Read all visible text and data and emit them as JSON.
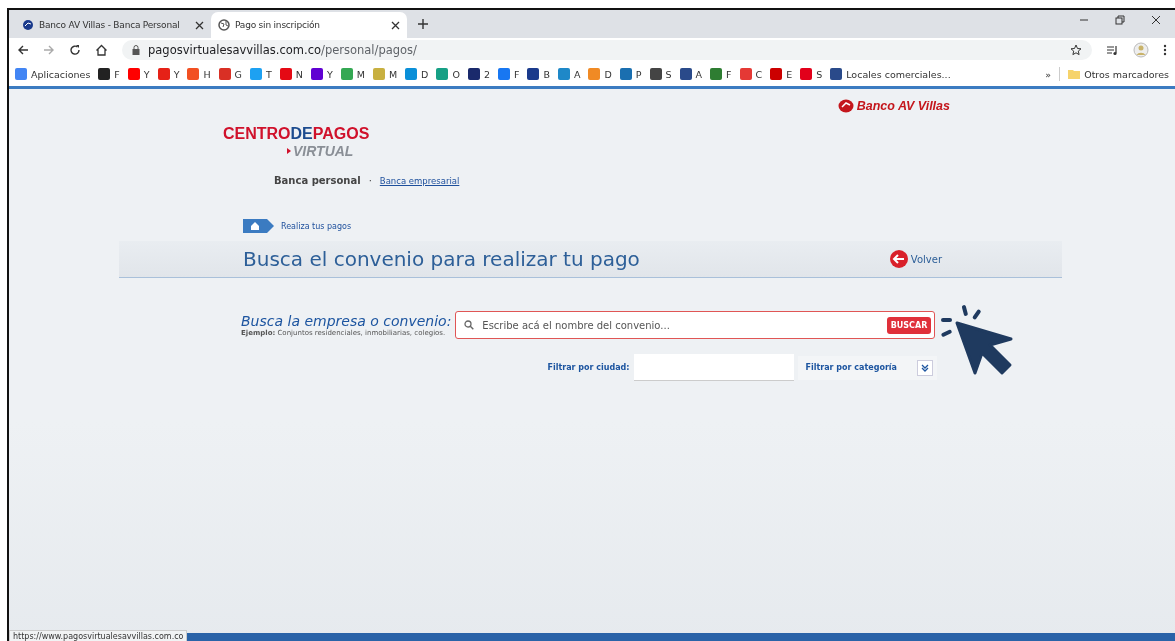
{
  "browser": {
    "tabs": [
      {
        "title": "Banco AV Villas - Banca Personal",
        "selected": false
      },
      {
        "title": "Pago sin inscripción",
        "selected": true
      }
    ],
    "address": {
      "domain": "pagosvirtualesavvillas.com.co",
      "path": "/personal/pagos/"
    },
    "bookmarks": [
      {
        "label": "Aplicaciones",
        "color": "#4285f4"
      },
      {
        "label": "F",
        "color": "#222222"
      },
      {
        "label": "Y",
        "color": "#ff0000"
      },
      {
        "label": "Y",
        "color": "#e62117"
      },
      {
        "label": "H",
        "color": "#f25022"
      },
      {
        "label": "G",
        "color": "#d93025"
      },
      {
        "label": "T",
        "color": "#1da1f2"
      },
      {
        "label": "N",
        "color": "#e50914"
      },
      {
        "label": "Y",
        "color": "#6001d2"
      },
      {
        "label": "M",
        "color": "#34a853"
      },
      {
        "label": "M",
        "color": "#c8b040"
      },
      {
        "label": "D",
        "color": "#0a8fd8"
      },
      {
        "label": "O",
        "color": "#16a085"
      },
      {
        "label": "2",
        "color": "#1a2a6c"
      },
      {
        "label": "F",
        "color": "#1877f2"
      },
      {
        "label": "B",
        "color": "#1a3a8c"
      },
      {
        "label": "A",
        "color": "#1e88c8"
      },
      {
        "label": "D",
        "color": "#f08a24"
      },
      {
        "label": "P",
        "color": "#1a6fb0"
      },
      {
        "label": "S",
        "color": "#444444"
      },
      {
        "label": "A",
        "color": "#2a4a8a"
      },
      {
        "label": "F",
        "color": "#2e7d32"
      },
      {
        "label": "C",
        "color": "#e53935"
      },
      {
        "label": "E",
        "color": "#cc0000"
      },
      {
        "label": "S",
        "color": "#e2001a"
      },
      {
        "label": "Locales comerciales...",
        "color": "#2a4a8a"
      }
    ],
    "overflow": "»",
    "other_bookmarks": "Otros marcadores",
    "status_url": "https://www.pagosvirtualesavvillas.com.co"
  },
  "page": {
    "bank_name": "Banco AV Villas",
    "logo": {
      "word_1": "CENTRO",
      "word_2": "DE",
      "word_3": "PAGOS",
      "word_4": "VIRTUAL"
    },
    "nav": [
      {
        "label": "Banca personal",
        "selected": true
      },
      {
        "label": "Banca empresarial",
        "selected": false
      }
    ],
    "nav_separator": "·",
    "breadcrumb": "Realiza tus pagos",
    "title": "Busca el convenio para realizar tu pago",
    "back": "Volver",
    "search": {
      "label": "Busca la empresa o convenio:",
      "example": "**Ejemplo:** Conjuntos residenciales, inmobiliarias, colegios.",
      "placeholder": "Escribe acá el nombre del convenio...",
      "button": "BUSCAR"
    },
    "city_filter": {
      "label": "Filtrar por ciudad:"
    },
    "category_filter": {
      "label": "Filtrar por categoría",
      "expanded": false
    }
  }
}
